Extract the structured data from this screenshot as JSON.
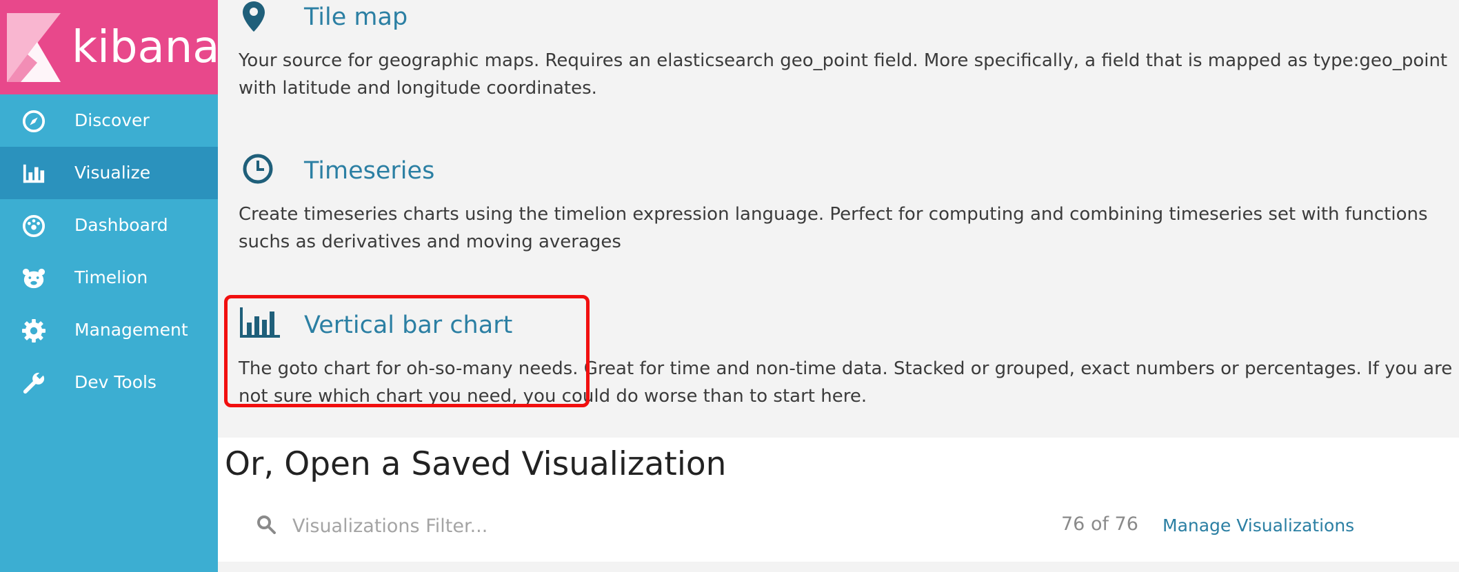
{
  "app": {
    "logo_text": "kibana",
    "brand_color": "#e8488b",
    "sidebar_color": "#3caed2",
    "active_color": "#2b92bd"
  },
  "sidebar": {
    "items": [
      {
        "label": "Discover",
        "icon": "compass-icon"
      },
      {
        "label": "Visualize",
        "icon": "bar-chart-icon",
        "active": true
      },
      {
        "label": "Dashboard",
        "icon": "dashboard-icon"
      },
      {
        "label": "Timelion",
        "icon": "timelion-bear-icon"
      },
      {
        "label": "Management",
        "icon": "gear-icon"
      },
      {
        "label": "Dev Tools",
        "icon": "wrench-icon"
      }
    ]
  },
  "visualization_types": [
    {
      "title": "Tile map",
      "icon": "map-pin-icon",
      "description": "Your source for geographic maps. Requires an elasticsearch geo_point field. More specifically, a field that is mapped as type:geo_point with latitude and longitude coordinates."
    },
    {
      "title": "Timeseries",
      "icon": "clock-icon",
      "description": "Create timeseries charts using the timelion expression language. Perfect for computing and combining timeseries set with functions suchs as derivatives and moving averages"
    },
    {
      "title": "Vertical bar chart",
      "icon": "vertical-bar-chart-icon",
      "highlighted": true,
      "description": "The goto chart for oh-so-many needs. Great for time and non-time data. Stacked or grouped, exact numbers or percentages. If you are not sure which chart you need, you could do worse than to start here."
    }
  ],
  "saved": {
    "title": "Or, Open a Saved Visualization",
    "filter_placeholder": "Visualizations Filter...",
    "count": "76 of 76",
    "manage_link": "Manage Visualizations"
  },
  "highlight_color": "#f10f0f"
}
